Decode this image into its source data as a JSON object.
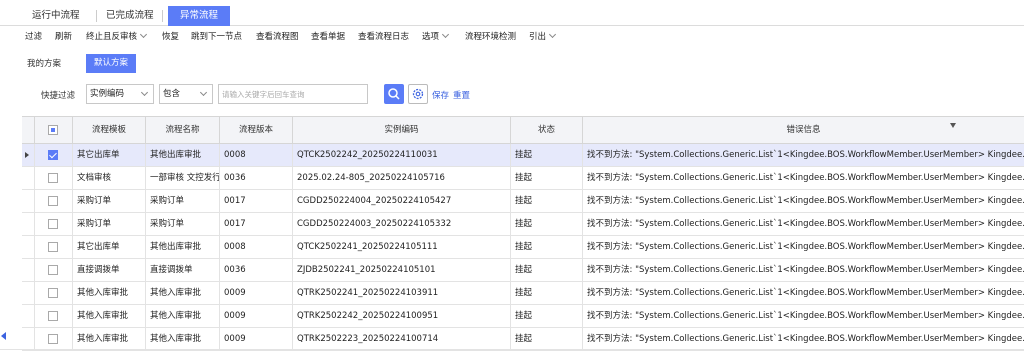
{
  "tabs": [
    {
      "label": "运行中流程",
      "active": false
    },
    {
      "label": "已完成流程",
      "active": false
    },
    {
      "label": "异常流程",
      "active": true
    }
  ],
  "toolbar": {
    "items": [
      "过滤",
      "刷新",
      "终止且反审核",
      "恢复",
      "跳到下一节点",
      "查看流程图",
      "查看单据",
      "查看流程日志",
      "选项",
      "流程环境检测",
      "引出"
    ]
  },
  "scheme": {
    "mine": "我的方案",
    "default": "默认方案"
  },
  "filter": {
    "label": "快捷过滤",
    "field": "实例编码",
    "operator": "包含",
    "placeholder": "请输入关键字后回车查询",
    "save": "保存",
    "reset": "重置"
  },
  "icons": {
    "search": "search-icon",
    "settings": "gear-icon",
    "filter": "filter-icon"
  },
  "colors": {
    "accent": "#5b7cf7",
    "link": "#3b62e0",
    "selected_row": "#e6e9fb"
  },
  "table": {
    "columns": [
      "流程模板",
      "流程名称",
      "流程版本",
      "实例编码",
      "状态",
      "错误信息"
    ],
    "rows": [
      {
        "template": "其它出库单",
        "name": "其他出库审批",
        "version": "0008",
        "code": "QTCK2502242_20250224110031",
        "status": "挂起",
        "error": "找不到方法: \"System.Collections.Generic.List`1<Kingdee.BOS.WorkflowMember.UserMember> Kingdee.",
        "selected": true
      },
      {
        "template": "文档审核",
        "name": "一部审核 文控发行",
        "version": "0036",
        "code": "2025.02.24-805_20250224105716",
        "status": "挂起",
        "error": "找不到方法: \"System.Collections.Generic.List`1<Kingdee.BOS.WorkflowMember.UserMember> Kingdee.",
        "selected": false
      },
      {
        "template": "采购订单",
        "name": "采购订单",
        "version": "0017",
        "code": "CGDD250224004_20250224105427",
        "status": "挂起",
        "error": "找不到方法: \"System.Collections.Generic.List`1<Kingdee.BOS.WorkflowMember.UserMember> Kingdee.",
        "selected": false
      },
      {
        "template": "采购订单",
        "name": "采购订单",
        "version": "0017",
        "code": "CGDD250224003_20250224105332",
        "status": "挂起",
        "error": "找不到方法: \"System.Collections.Generic.List`1<Kingdee.BOS.WorkflowMember.UserMember> Kingdee.",
        "selected": false
      },
      {
        "template": "其它出库单",
        "name": "其他出库审批",
        "version": "0008",
        "code": "QTCK2502241_20250224105111",
        "status": "挂起",
        "error": "找不到方法: \"System.Collections.Generic.List`1<Kingdee.BOS.WorkflowMember.UserMember> Kingdee.",
        "selected": false
      },
      {
        "template": "直接调拨单",
        "name": "直接调拨单",
        "version": "0036",
        "code": "ZJDB2502241_20250224105101",
        "status": "挂起",
        "error": "找不到方法: \"System.Collections.Generic.List`1<Kingdee.BOS.WorkflowMember.UserMember> Kingdee.",
        "selected": false
      },
      {
        "template": "其他入库审批",
        "name": "其他入库审批",
        "version": "0009",
        "code": "QTRK2502241_20250224103911",
        "status": "挂起",
        "error": "找不到方法: \"System.Collections.Generic.List`1<Kingdee.BOS.WorkflowMember.UserMember> Kingdee.",
        "selected": false
      },
      {
        "template": "其他入库审批",
        "name": "其他入库审批",
        "version": "0009",
        "code": "QTRK2502242_20250224100951",
        "status": "挂起",
        "error": "找不到方法: \"System.Collections.Generic.List`1<Kingdee.BOS.WorkflowMember.UserMember> Kingdee.",
        "selected": false
      },
      {
        "template": "其他入库审批",
        "name": "其他入库审批",
        "version": "0009",
        "code": "QTRK2502223_20250224100714",
        "status": "挂起",
        "error": "找不到方法: \"System.Collections.Generic.List`1<Kingdee.BOS.WorkflowMember.UserMember> Kingdee.",
        "selected": false
      }
    ]
  }
}
